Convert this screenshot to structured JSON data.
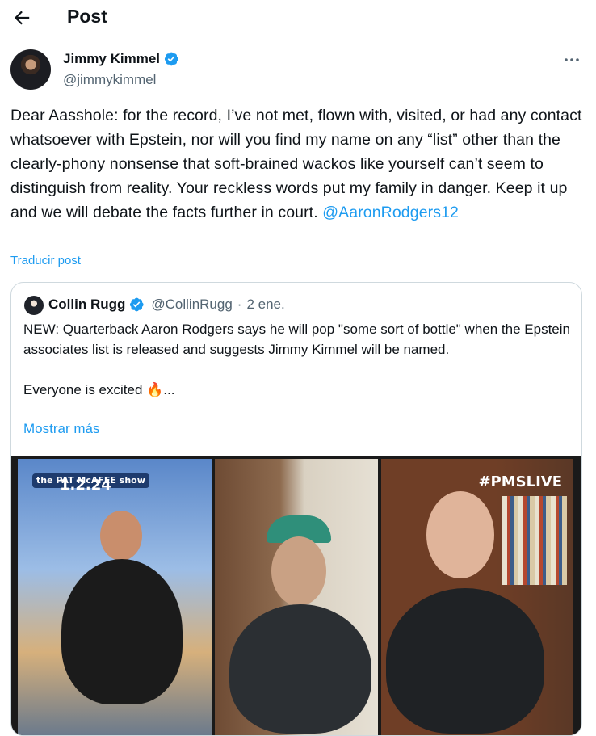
{
  "header": {
    "title": "Post"
  },
  "tweet": {
    "author_name": "Jimmy Kimmel",
    "author_handle": "@jimmykimmel",
    "text": "Dear Aasshole: for the record, I’ve not met, flown with, visited, or had any contact whatsoever with Epstein, nor will you find my name on any “list” other than the clearly-phony nonsense that soft-brained wackos like yourself can’t seem to distinguish from reality. Your reckless words put my family in danger. Keep it up and we will debate the facts further in court.",
    "mention": "@AaronRodgers12",
    "translate_label": "Traducir post"
  },
  "quote": {
    "author_name": "Collin Rugg",
    "author_handle": "@CollinRugg",
    "separator": "·",
    "date": "2 ene.",
    "text_line1": "NEW: Quarterback Aaron Rodgers says he will pop \"some sort of bottle\" when the Epstein associates list is released and suggests Jimmy Kimmel will be named.",
    "text_line2": "Everyone is excited 🔥...",
    "show_more": "Mostrar más",
    "video": {
      "show_logo": "the PAT McAFEE show",
      "date_overlay": "1.2.24",
      "live_tag": "#PMSLIVE"
    }
  },
  "colors": {
    "accent": "#1d9bf0",
    "secondary_text": "#536471",
    "border": "#cfd9de",
    "verified": "#1d9bf0"
  }
}
